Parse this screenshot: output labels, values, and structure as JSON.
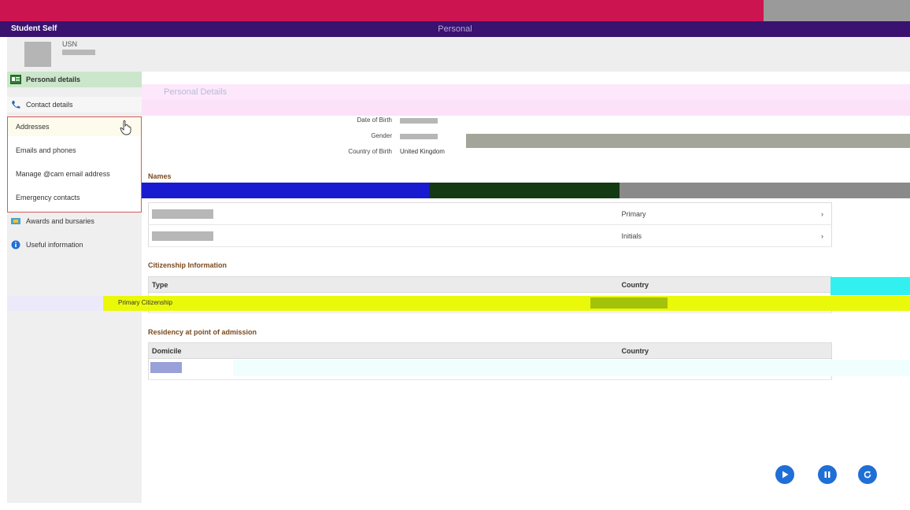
{
  "header": {
    "brand": "Student Self",
    "title": "Personal"
  },
  "user": {
    "usn_label": "USN"
  },
  "sidebar": {
    "personal_details": "Personal details",
    "contact_details": "Contact details",
    "submenu": [
      "Addresses",
      "Emails and phones",
      "Manage @cam email address",
      "Emergency contacts"
    ],
    "awards": "Awards and bursaries",
    "useful": "Useful information"
  },
  "personal": {
    "title": "Personal Details",
    "dob_label": "Date of Birth",
    "gender_label": "Gender",
    "cob_label": "Country of Birth",
    "cob_value": "United Kingdom"
  },
  "names": {
    "heading": "Names",
    "rows": [
      {
        "type": "Primary"
      },
      {
        "type": "Initials"
      }
    ]
  },
  "citizenship": {
    "heading": "Citizenship Information",
    "col_type": "Type",
    "col_country": "Country",
    "row_type": "Primary Citizenship"
  },
  "residency": {
    "heading": "Residency at point of admission",
    "col_domicile": "Domicile",
    "col_country": "Country"
  },
  "controls": {
    "play": "play-icon",
    "pause": "pause-icon",
    "refresh": "refresh-icon"
  },
  "colors": {
    "accent": "#1f6fd6",
    "header": "#3a1270",
    "heading": "#7a4a21"
  }
}
